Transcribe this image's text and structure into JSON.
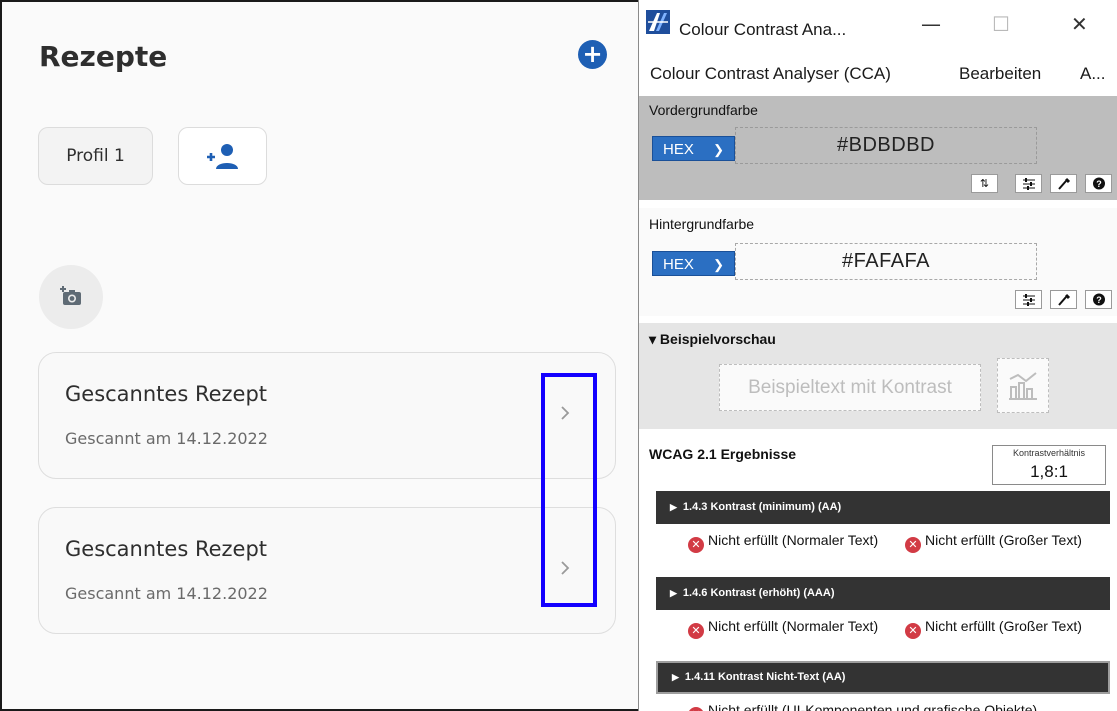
{
  "app": {
    "title": "Rezepte",
    "add_button_symbol": "+",
    "profile_button_label": "Profil 1",
    "add_profile_icon": "person-add-icon",
    "camera_icon": "add-photo-icon",
    "cards": [
      {
        "title": "Gescanntes Rezept",
        "subtitle": "Gescannt am 14.12.2022"
      },
      {
        "title": "Gescanntes Rezept",
        "subtitle": "Gescannt am 14.12.2022"
      }
    ],
    "colors": {
      "accent": "#1e5fb4",
      "focus_outline": "#1400ff",
      "background": "#fafafa"
    }
  },
  "cca": {
    "window_title": "Colour Contrast Ana...",
    "window_controls": {
      "minimize": "—",
      "maximize": "☐",
      "close": "✕"
    },
    "menu": [
      "Colour Contrast Analyser (CCA)",
      "Bearbeiten",
      "A..."
    ],
    "foreground": {
      "label": "Vordergrundfarbe",
      "format": "HEX",
      "value": "#BDBDBD"
    },
    "background": {
      "label": "Hintergrundfarbe",
      "format": "HEX",
      "value": "#FAFAFA"
    },
    "preview": {
      "label": "Beispielvorschau",
      "sample_text": "Beispieltext mit Kontrast"
    },
    "results": {
      "title": "WCAG 2.1 Ergebnisse",
      "ratio_label": "Kontrastverhältnis",
      "ratio_value": "1,8:1",
      "criteria": [
        {
          "label": "1.4.3 Kontrast (minimum) (AA)",
          "left": "Nicht erfüllt (Normaler Text)",
          "right": "Nicht erfüllt (Großer Text)"
        },
        {
          "label": "1.4.6 Kontrast (erhöht) (AAA)",
          "left": "Nicht erfüllt (Normaler Text)",
          "right": "Nicht erfüllt (Großer Text)"
        },
        {
          "label": "1.4.11 Kontrast Nicht-Text (AA)",
          "left": "Nicht erfüllt (UI-Komponenten und grafische Objekte)"
        }
      ]
    },
    "colors": {
      "foreground": "#BDBDBD",
      "background": "#FAFAFA",
      "select_blue": "#2b6fc2",
      "fail_red": "#d23b45"
    }
  }
}
